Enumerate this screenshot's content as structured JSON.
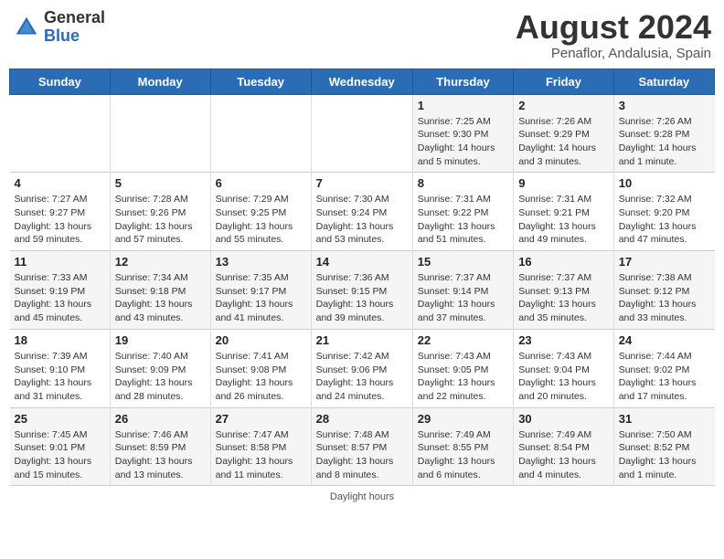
{
  "header": {
    "logo_general": "General",
    "logo_blue": "Blue",
    "month_title": "August 2024",
    "subtitle": "Penaflor, Andalusia, Spain"
  },
  "days_of_week": [
    "Sunday",
    "Monday",
    "Tuesday",
    "Wednesday",
    "Thursday",
    "Friday",
    "Saturday"
  ],
  "weeks": [
    [
      {
        "day": "",
        "info": ""
      },
      {
        "day": "",
        "info": ""
      },
      {
        "day": "",
        "info": ""
      },
      {
        "day": "",
        "info": ""
      },
      {
        "day": "1",
        "info": "Sunrise: 7:25 AM\nSunset: 9:30 PM\nDaylight: 14 hours\nand 5 minutes."
      },
      {
        "day": "2",
        "info": "Sunrise: 7:26 AM\nSunset: 9:29 PM\nDaylight: 14 hours\nand 3 minutes."
      },
      {
        "day": "3",
        "info": "Sunrise: 7:26 AM\nSunset: 9:28 PM\nDaylight: 14 hours\nand 1 minute."
      }
    ],
    [
      {
        "day": "4",
        "info": "Sunrise: 7:27 AM\nSunset: 9:27 PM\nDaylight: 13 hours\nand 59 minutes."
      },
      {
        "day": "5",
        "info": "Sunrise: 7:28 AM\nSunset: 9:26 PM\nDaylight: 13 hours\nand 57 minutes."
      },
      {
        "day": "6",
        "info": "Sunrise: 7:29 AM\nSunset: 9:25 PM\nDaylight: 13 hours\nand 55 minutes."
      },
      {
        "day": "7",
        "info": "Sunrise: 7:30 AM\nSunset: 9:24 PM\nDaylight: 13 hours\nand 53 minutes."
      },
      {
        "day": "8",
        "info": "Sunrise: 7:31 AM\nSunset: 9:22 PM\nDaylight: 13 hours\nand 51 minutes."
      },
      {
        "day": "9",
        "info": "Sunrise: 7:31 AM\nSunset: 9:21 PM\nDaylight: 13 hours\nand 49 minutes."
      },
      {
        "day": "10",
        "info": "Sunrise: 7:32 AM\nSunset: 9:20 PM\nDaylight: 13 hours\nand 47 minutes."
      }
    ],
    [
      {
        "day": "11",
        "info": "Sunrise: 7:33 AM\nSunset: 9:19 PM\nDaylight: 13 hours\nand 45 minutes."
      },
      {
        "day": "12",
        "info": "Sunrise: 7:34 AM\nSunset: 9:18 PM\nDaylight: 13 hours\nand 43 minutes."
      },
      {
        "day": "13",
        "info": "Sunrise: 7:35 AM\nSunset: 9:17 PM\nDaylight: 13 hours\nand 41 minutes."
      },
      {
        "day": "14",
        "info": "Sunrise: 7:36 AM\nSunset: 9:15 PM\nDaylight: 13 hours\nand 39 minutes."
      },
      {
        "day": "15",
        "info": "Sunrise: 7:37 AM\nSunset: 9:14 PM\nDaylight: 13 hours\nand 37 minutes."
      },
      {
        "day": "16",
        "info": "Sunrise: 7:37 AM\nSunset: 9:13 PM\nDaylight: 13 hours\nand 35 minutes."
      },
      {
        "day": "17",
        "info": "Sunrise: 7:38 AM\nSunset: 9:12 PM\nDaylight: 13 hours\nand 33 minutes."
      }
    ],
    [
      {
        "day": "18",
        "info": "Sunrise: 7:39 AM\nSunset: 9:10 PM\nDaylight: 13 hours\nand 31 minutes."
      },
      {
        "day": "19",
        "info": "Sunrise: 7:40 AM\nSunset: 9:09 PM\nDaylight: 13 hours\nand 28 minutes."
      },
      {
        "day": "20",
        "info": "Sunrise: 7:41 AM\nSunset: 9:08 PM\nDaylight: 13 hours\nand 26 minutes."
      },
      {
        "day": "21",
        "info": "Sunrise: 7:42 AM\nSunset: 9:06 PM\nDaylight: 13 hours\nand 24 minutes."
      },
      {
        "day": "22",
        "info": "Sunrise: 7:43 AM\nSunset: 9:05 PM\nDaylight: 13 hours\nand 22 minutes."
      },
      {
        "day": "23",
        "info": "Sunrise: 7:43 AM\nSunset: 9:04 PM\nDaylight: 13 hours\nand 20 minutes."
      },
      {
        "day": "24",
        "info": "Sunrise: 7:44 AM\nSunset: 9:02 PM\nDaylight: 13 hours\nand 17 minutes."
      }
    ],
    [
      {
        "day": "25",
        "info": "Sunrise: 7:45 AM\nSunset: 9:01 PM\nDaylight: 13 hours\nand 15 minutes."
      },
      {
        "day": "26",
        "info": "Sunrise: 7:46 AM\nSunset: 8:59 PM\nDaylight: 13 hours\nand 13 minutes."
      },
      {
        "day": "27",
        "info": "Sunrise: 7:47 AM\nSunset: 8:58 PM\nDaylight: 13 hours\nand 11 minutes."
      },
      {
        "day": "28",
        "info": "Sunrise: 7:48 AM\nSunset: 8:57 PM\nDaylight: 13 hours\nand 8 minutes."
      },
      {
        "day": "29",
        "info": "Sunrise: 7:49 AM\nSunset: 8:55 PM\nDaylight: 13 hours\nand 6 minutes."
      },
      {
        "day": "30",
        "info": "Sunrise: 7:49 AM\nSunset: 8:54 PM\nDaylight: 13 hours\nand 4 minutes."
      },
      {
        "day": "31",
        "info": "Sunrise: 7:50 AM\nSunset: 8:52 PM\nDaylight: 13 hours\nand 1 minute."
      }
    ]
  ],
  "footer": "Daylight hours"
}
